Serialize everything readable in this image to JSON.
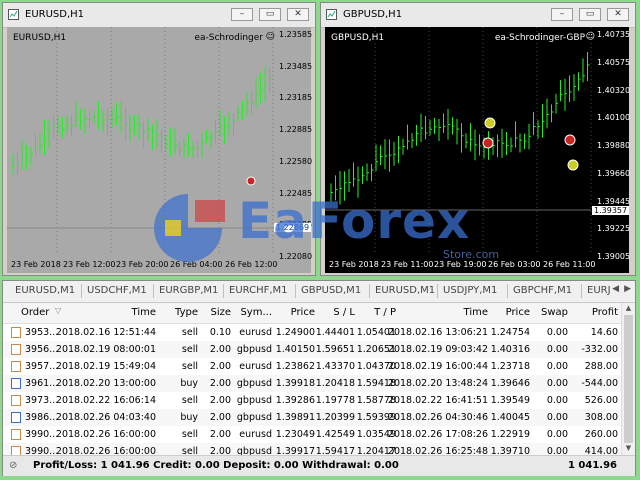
{
  "windows": [
    {
      "title": "EURUSD,H1",
      "symbol_label": "EURUSD,H1",
      "ea_label": "ea-Schrodinger",
      "price_levels": [
        "1.23585",
        "1.23485",
        "1.23185",
        "1.22885",
        "1.22580",
        "1.22485",
        "1.22285",
        "1.22080"
      ],
      "marked_price": "1.22869",
      "time_labels": [
        "23 Feb 2018",
        "23 Feb 12:00",
        "23 Feb 20:00",
        "26 Feb 04:00",
        "26 Feb 12:00"
      ],
      "colors": {
        "bg": "#a9a9a9",
        "bar": "#22ee22",
        "text": "#000000",
        "marker": "#cc2222"
      }
    },
    {
      "title": "GBPUSD,H1",
      "symbol_label": "GBPUSD,H1",
      "ea_label": "ea-Schrodinger-GBP",
      "price_levels": [
        "1.40735",
        "1.40575",
        "1.40320",
        "1.40100",
        "1.39880",
        "1.39660",
        "1.39445",
        "1.39225",
        "1.39005"
      ],
      "marked_price": "1.39357",
      "time_labels": [
        "23 Feb 2018",
        "23 Feb 11:00",
        "23 Feb 19:00",
        "26 Feb 03:00",
        "26 Feb 11:00"
      ],
      "colors": {
        "bg": "#000000",
        "bar": "#22ee22",
        "text": "#ffffff",
        "marker": "#cccc22"
      }
    }
  ],
  "watermark": {
    "brand_text": "EaForex",
    "sub_text": "Store.com"
  },
  "tabs": [
    "EURUSD,M1",
    "USDCHF,M1",
    "EURGBP,M1",
    "EURCHF,M1",
    "GBPUSD,M1",
    "EURUSD,M1",
    "USDJPY,M1",
    "GBPCHF,M1",
    "EURJ"
  ],
  "table": {
    "headers": [
      "Order",
      "Time",
      "Type",
      "Size",
      "Sym...",
      "Price",
      "S / L",
      "T / P",
      "Time",
      "Price",
      "Swap",
      "Profit"
    ],
    "rows": [
      [
        "3953...",
        "2018.02.16 12:51:44",
        "sell",
        "0.10",
        "eurusd",
        "1.24900",
        "1.44401",
        "1.05401",
        "2018.02.16 13:06:21",
        "1.24754",
        "0.00",
        "14.60"
      ],
      [
        "3956...",
        "2018.02.19 08:00:01",
        "sell",
        "2.00",
        "gbpusd",
        "1.40150",
        "1.59651",
        "1.20651",
        "2018.02.19 09:03:42",
        "1.40316",
        "0.00",
        "-332.00"
      ],
      [
        "3957...",
        "2018.02.19 15:49:04",
        "sell",
        "2.00",
        "eurusd",
        "1.23862",
        "1.43370",
        "1.04370",
        "2018.02.19 16:00:44",
        "1.23718",
        "0.00",
        "288.00"
      ],
      [
        "3961...",
        "2018.02.20 13:00:00",
        "buy",
        "2.00",
        "gbpusd",
        "1.39918",
        "1.20418",
        "1.59418",
        "2018.02.20 13:48:24",
        "1.39646",
        "0.00",
        "-544.00"
      ],
      [
        "3973...",
        "2018.02.22 16:06:14",
        "sell",
        "2.00",
        "gbpusd",
        "1.39286",
        "1.19778",
        "1.58778",
        "2018.02.22 16:41:51",
        "1.39549",
        "0.00",
        "526.00"
      ],
      [
        "3986...",
        "2018.02.26 04:03:40",
        "buy",
        "2.00",
        "gbpusd",
        "1.39891",
        "1.20399",
        "1.59399",
        "2018.02.26 04:30:46",
        "1.40045",
        "0.00",
        "308.00"
      ],
      [
        "3990...",
        "2018.02.26 16:00:00",
        "sell",
        "2.00",
        "eurusd",
        "1.23049",
        "1.42549",
        "1.03549",
        "2018.02.26 17:08:26",
        "1.22919",
        "0.00",
        "260.00"
      ],
      [
        "3990...",
        "2018.02.26 16:00:00",
        "sell",
        "2.00",
        "gbpusd",
        "1.39917",
        "1.59417",
        "1.20417",
        "2018.02.26 16:25:48",
        "1.39710",
        "0.00",
        "414.00"
      ]
    ]
  },
  "summary": {
    "text": "Profit/Loss: 1 041.96  Credit: 0.00  Deposit: 0.00  Withdrawal: 0.00",
    "total": "1 041.96"
  },
  "window_controls": {
    "minimize": "–",
    "restore": "▭",
    "close": "✕"
  }
}
